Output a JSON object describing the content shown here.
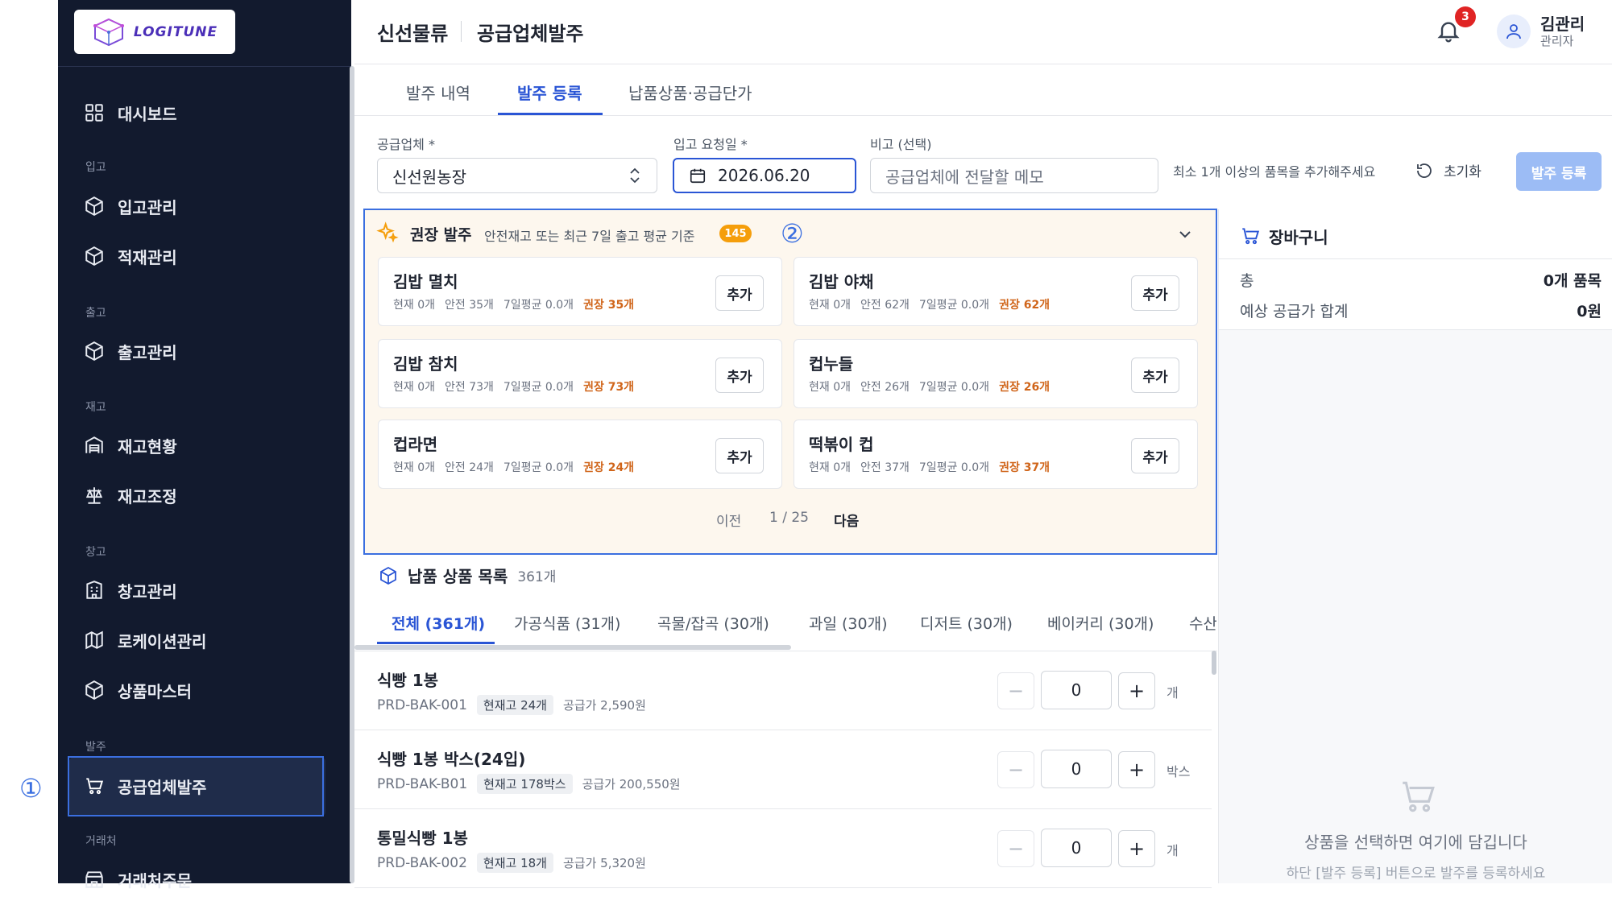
{
  "colors": {
    "primary": "#2a55d5",
    "sidebar": "#121a2e",
    "highlight": "#3b6fe0",
    "recommend_bg": "#fdf7ee",
    "recommend_text": "#d0651a"
  },
  "logo": {
    "text": "LOGITUNE"
  },
  "sidebar": {
    "items": [
      {
        "label": "대시보드",
        "icon": "dashboard-icon"
      },
      {
        "section": "입고"
      },
      {
        "label": "입고관리",
        "icon": "box-icon"
      },
      {
        "label": "적재관리",
        "icon": "box-icon"
      },
      {
        "section": "출고"
      },
      {
        "label": "출고관리",
        "icon": "box-icon"
      },
      {
        "section": "재고"
      },
      {
        "label": "재고현황",
        "icon": "warehouse-icon"
      },
      {
        "label": "재고조정",
        "icon": "scale-icon"
      },
      {
        "section": "창고"
      },
      {
        "label": "창고관리",
        "icon": "building-icon"
      },
      {
        "label": "로케이션관리",
        "icon": "map-icon"
      },
      {
        "label": "상품마스터",
        "icon": "box-icon"
      },
      {
        "section": "발주"
      },
      {
        "label": "공급업체발주",
        "icon": "cart-icon",
        "active": true
      },
      {
        "section": "거래처"
      },
      {
        "label": "거래처주문",
        "icon": "store-icon"
      }
    ]
  },
  "markers": {
    "m1": "①",
    "m2": "②"
  },
  "header": {
    "breadcrumb1": "신선물류",
    "breadcrumb2": "공급업체발주",
    "notif_count": "3",
    "user_name": "김관리",
    "user_role": "관리자"
  },
  "tabs": [
    {
      "label": "발주 내역"
    },
    {
      "label": "발주 등록",
      "active": true
    },
    {
      "label": "납품상품·공급단가"
    }
  ],
  "form": {
    "supplier_label": "공급업체 *",
    "supplier_value": "신선원농장",
    "date_label": "입고 요청일 *",
    "date_value": "2026.06.20",
    "memo_label": "비고 (선택)",
    "memo_placeholder": "공급업체에 전달할 메모",
    "hint": "최소 1개 이상의 품목을 추가해주세요",
    "reset_label": "초기화",
    "submit_label": "발주 등록"
  },
  "recommend": {
    "title": "권장 발주",
    "subtitle": "안전재고 또는 최근 7일 출고 평균 기준",
    "badge": "145",
    "cards": [
      {
        "name": "김밥 멸치",
        "current": "현재 0개",
        "safety": "안전 35개",
        "avg": "7일평균 0.0개",
        "rec": "권장 35개",
        "add": "추가"
      },
      {
        "name": "김밥 야채",
        "current": "현재 0개",
        "safety": "안전 62개",
        "avg": "7일평균 0.0개",
        "rec": "권장 62개",
        "add": "추가"
      },
      {
        "name": "김밥 참치",
        "current": "현재 0개",
        "safety": "안전 73개",
        "avg": "7일평균 0.0개",
        "rec": "권장 73개",
        "add": "추가"
      },
      {
        "name": "컵누들",
        "current": "현재 0개",
        "safety": "안전 26개",
        "avg": "7일평균 0.0개",
        "rec": "권장 26개",
        "add": "추가"
      },
      {
        "name": "컵라면",
        "current": "현재 0개",
        "safety": "안전 24개",
        "avg": "7일평균 0.0개",
        "rec": "권장 24개",
        "add": "추가"
      },
      {
        "name": "떡볶이 컵",
        "current": "현재 0개",
        "safety": "안전 37개",
        "avg": "7일평균 0.0개",
        "rec": "권장 37개",
        "add": "추가"
      }
    ],
    "pager": {
      "prev": "이전",
      "page": "1 / 25",
      "next": "다음"
    }
  },
  "products": {
    "title": "납품 상품 목록",
    "count": "361개",
    "categories": [
      "전체 (361개)",
      "가공식품 (31개)",
      "곡물/잡곡 (30개)",
      "과일 (30개)",
      "디저트 (30개)",
      "베이커리 (30개)",
      "수산"
    ],
    "rows": [
      {
        "name": "식빵 1봉",
        "code": "PRD-BAK-001",
        "stock": "현재고 24개",
        "price": "공급가 2,590원",
        "qty": "0",
        "unit": "개"
      },
      {
        "name": "식빵 1봉 박스(24입)",
        "code": "PRD-BAK-B01",
        "stock": "현재고 178박스",
        "price": "공급가 200,550원",
        "qty": "0",
        "unit": "박스"
      },
      {
        "name": "통밀식빵 1봉",
        "code": "PRD-BAK-002",
        "stock": "현재고 18개",
        "price": "공급가 5,320원",
        "qty": "0",
        "unit": "개"
      }
    ]
  },
  "cart": {
    "title": "장바구니",
    "total_label": "총",
    "total_value": "0개 품목",
    "sum_label": "예상 공급가 합계",
    "sum_value": "0원",
    "empty_title": "상품을 선택하면 여기에 담깁니다",
    "empty_sub": "하단 [발주 등록] 버튼으로 발주를 등록하세요"
  }
}
